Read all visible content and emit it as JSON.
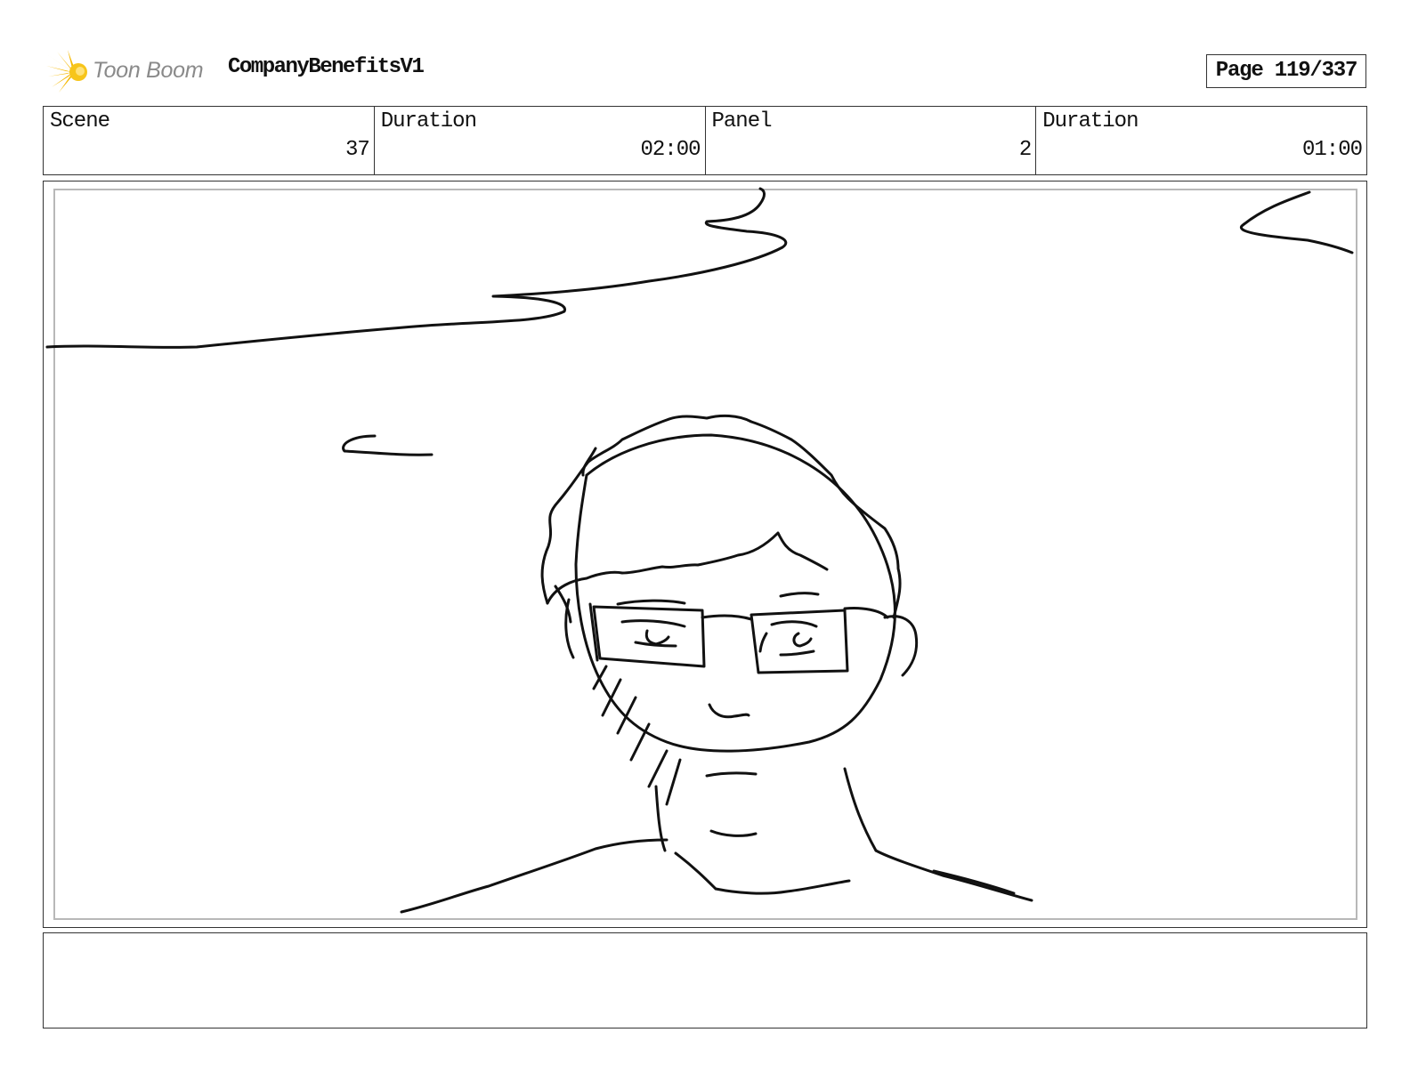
{
  "header": {
    "logo_text": "Toon Boom",
    "project_title": "CompanyBenefitsV1",
    "page_label": "Page 119/337"
  },
  "info": {
    "scene_label": "Scene",
    "scene_value": "37",
    "scene_duration_label": "Duration",
    "scene_duration_value": "02:00",
    "panel_label": "Panel",
    "panel_value": "2",
    "panel_duration_label": "Duration",
    "panel_duration_value": "01:00"
  },
  "panel_image": {
    "icon": "storyboard-sketch"
  },
  "notes": {
    "text": ""
  }
}
